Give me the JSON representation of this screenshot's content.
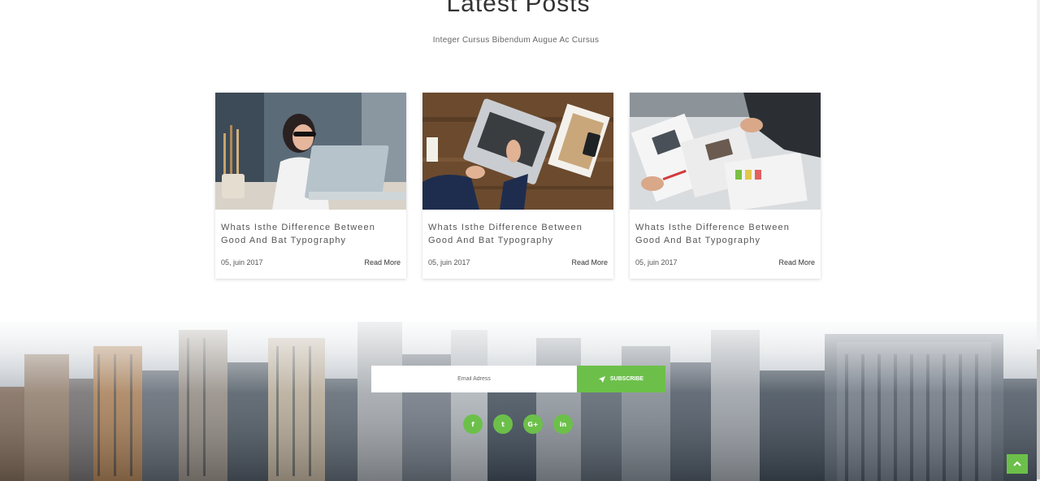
{
  "section": {
    "title": "Latest Posts",
    "subtitle": "Integer Cursus Bibendum Augue Ac Cursus"
  },
  "posts": [
    {
      "title": "Whats Isthe Difference Between Good And Bat Typography",
      "date": "05, juin 2017",
      "read_more": "Read More",
      "image": "woman-at-laptop-photo"
    },
    {
      "title": "Whats Isthe Difference Between Good And Bat Typography",
      "date": "05, juin 2017",
      "read_more": "Read More",
      "image": "laptop-on-wooden-desk-photo"
    },
    {
      "title": "Whats Isthe Difference Between Good And Bat Typography",
      "date": "05, juin 2017",
      "read_more": "Read More",
      "image": "meeting-with-documents-photo"
    }
  ],
  "subscribe": {
    "placeholder": "Email Adress",
    "button_label": "SUBSCRIBE",
    "button_icon": "paper-plane-icon"
  },
  "social": [
    {
      "name": "facebook-icon",
      "glyph": "f"
    },
    {
      "name": "twitter-icon",
      "glyph": "t"
    },
    {
      "name": "google-plus-icon",
      "glyph": "G+"
    },
    {
      "name": "linkedin-icon",
      "glyph": "in"
    }
  ],
  "colors": {
    "accent": "#6cc04a",
    "text": "#555555",
    "background": "#ffffff"
  }
}
